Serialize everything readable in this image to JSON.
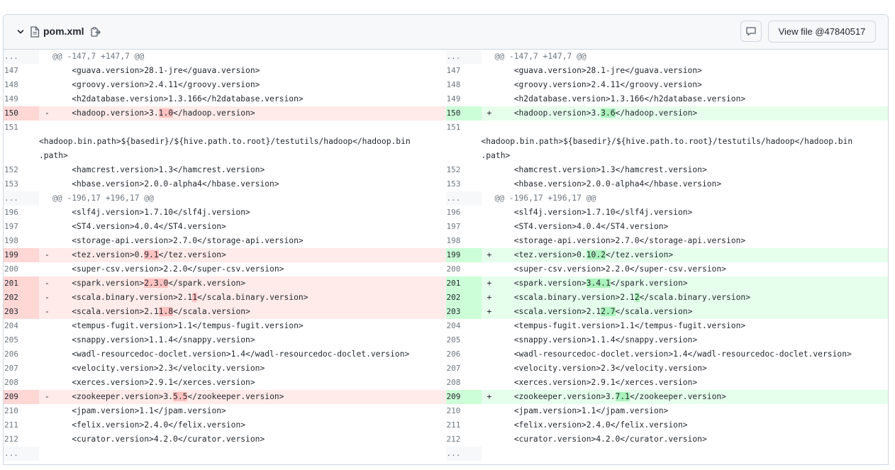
{
  "file": {
    "name": "pom.xml",
    "view_button": "View file @47840517"
  },
  "hunks": [
    {
      "header": "@@ -147,7 +147,7 @@"
    },
    {
      "header": "@@ -196,17 +196,17 @@"
    }
  ],
  "rows": [
    {
      "type": "hunk",
      "l": "...",
      "r": "...",
      "text": "@@ -147,7 +147,7 @@"
    },
    {
      "type": "ctx",
      "l": "147",
      "r": "147",
      "text": "    <guava.version>28.1-jre</guava.version>"
    },
    {
      "type": "ctx",
      "l": "148",
      "r": "148",
      "text": "    <groovy.version>2.4.11</groovy.version>"
    },
    {
      "type": "ctx",
      "l": "149",
      "r": "149",
      "text": "    <h2database.version>1.3.166</h2database.version>"
    },
    {
      "type": "chg",
      "l": "150",
      "r": "150",
      "lpre": "    <hadoop.version>3.",
      "lhl": "1.0",
      "lpost": "</hadoop.version>",
      "rpre": "    <hadoop.version>3.",
      "rhl": "3.6",
      "rpost": "</hadoop.version>"
    },
    {
      "type": "wrap",
      "l": "151",
      "r": "151",
      "line1": "",
      "line2": "<hadoop.bin.path>${basedir}/${hive.path.to.root}/testutils/hadoop</hadoop.bin",
      "line3": ".path>"
    },
    {
      "type": "ctx",
      "l": "152",
      "r": "152",
      "text": "    <hamcrest.version>1.3</hamcrest.version>"
    },
    {
      "type": "ctx",
      "l": "153",
      "r": "153",
      "text": "    <hbase.version>2.0.0-alpha4</hbase.version>"
    },
    {
      "type": "hunk",
      "l": "...",
      "r": "...",
      "text": "@@ -196,17 +196,17 @@"
    },
    {
      "type": "ctx",
      "l": "196",
      "r": "196",
      "text": "    <slf4j.version>1.7.10</slf4j.version>"
    },
    {
      "type": "ctx",
      "l": "197",
      "r": "197",
      "text": "    <ST4.version>4.0.4</ST4.version>"
    },
    {
      "type": "ctx",
      "l": "198",
      "r": "198",
      "text": "    <storage-api.version>2.7.0</storage-api.version>"
    },
    {
      "type": "chg",
      "l": "199",
      "r": "199",
      "lpre": "    <tez.version>0.",
      "lhl": "9.1",
      "lpost": "</tez.version>",
      "rpre": "    <tez.version>0.",
      "rhl": "10.2",
      "rpost": "</tez.version>"
    },
    {
      "type": "ctx",
      "l": "200",
      "r": "200",
      "text": "    <super-csv.version>2.2.0</super-csv.version>"
    },
    {
      "type": "chg",
      "l": "201",
      "r": "201",
      "lpre": "    <spark.version>",
      "lhl": "2.3.0",
      "lpost": "</spark.version>",
      "rpre": "    <spark.version>",
      "rhl": "3.4.1",
      "rpost": "</spark.version>"
    },
    {
      "type": "chg",
      "l": "202",
      "r": "202",
      "lpre": "    <scala.binary.version>2.1",
      "lhl": "1",
      "lpost": "</scala.binary.version>",
      "rpre": "    <scala.binary.version>2.1",
      "rhl": "2",
      "rpost": "</scala.binary.version>"
    },
    {
      "type": "chg",
      "l": "203",
      "r": "203",
      "lpre": "    <scala.version>2.1",
      "lhl": "1.8",
      "lpost": "</scala.version>",
      "rpre": "    <scala.version>2.1",
      "rhl": "2.7",
      "rpost": "</scala.version>"
    },
    {
      "type": "ctx",
      "l": "204",
      "r": "204",
      "text": "    <tempus-fugit.version>1.1</tempus-fugit.version>"
    },
    {
      "type": "ctx",
      "l": "205",
      "r": "205",
      "text": "    <snappy.version>1.1.4</snappy.version>"
    },
    {
      "type": "ctx",
      "l": "206",
      "r": "206",
      "text": "    <wadl-resourcedoc-doclet.version>1.4</wadl-resourcedoc-doclet.version>"
    },
    {
      "type": "ctx",
      "l": "207",
      "r": "207",
      "text": "    <velocity.version>2.3</velocity.version>"
    },
    {
      "type": "ctx",
      "l": "208",
      "r": "208",
      "text": "    <xerces.version>2.9.1</xerces.version>"
    },
    {
      "type": "chg",
      "l": "209",
      "r": "209",
      "lpre": "    <zookeeper.version>3.",
      "lhl": "5.5",
      "lpost": "</zookeeper.version>",
      "rpre": "    <zookeeper.version>3.",
      "rhl": "7.1",
      "rpost": "</zookeeper.version>"
    },
    {
      "type": "ctx",
      "l": "210",
      "r": "210",
      "text": "    <jpam.version>1.1</jpam.version>"
    },
    {
      "type": "ctx",
      "l": "211",
      "r": "211",
      "text": "    <felix.version>2.4.0</felix.version>"
    },
    {
      "type": "ctx",
      "l": "212",
      "r": "212",
      "text": "    <curator.version>4.2.0</curator.version>"
    },
    {
      "type": "hunk",
      "l": "...",
      "r": "...",
      "text": ""
    }
  ],
  "markers": {
    "del": "-",
    "add": "+"
  },
  "colors": {
    "del_bg": "#ffebe9",
    "add_bg": "#e6ffec",
    "del_num": "#ffd7d5",
    "add_num": "#ccffd8"
  }
}
